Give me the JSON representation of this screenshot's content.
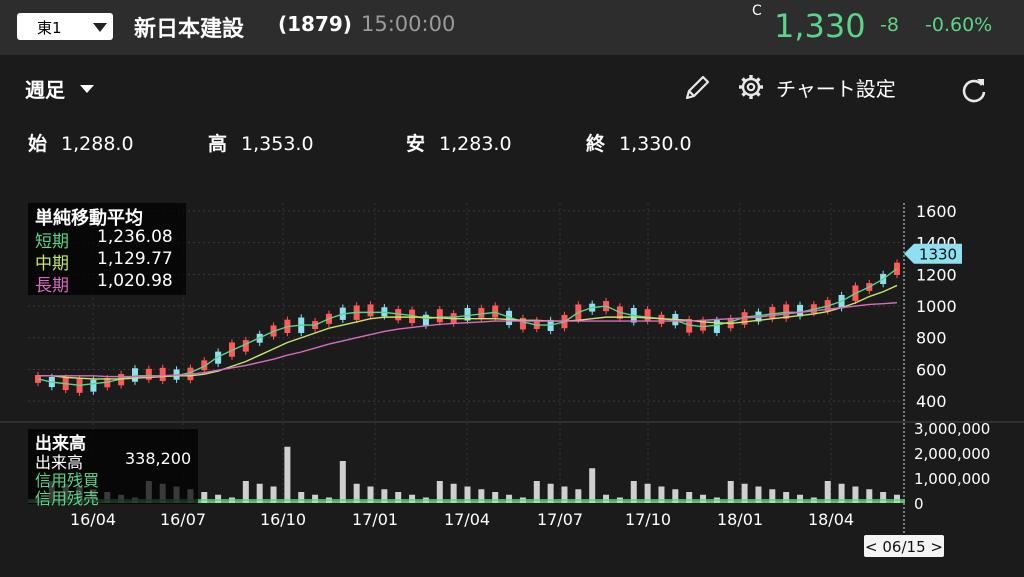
{
  "header": {
    "market": "東1",
    "name": "新日本建設",
    "code": "(1879)",
    "time": "15:00:00",
    "c_mark": "C",
    "price": "1,330",
    "change": "-8",
    "change_pct": "-0.60%"
  },
  "toolbar": {
    "period": "週足",
    "settings_label": "チャート設定"
  },
  "ohlc": {
    "open_label": "始",
    "open": "1,288.0",
    "high_label": "高",
    "high": "1,353.0",
    "low_label": "安",
    "low": "1,283.0",
    "close_label": "終",
    "close": "1,330.0"
  },
  "ma_legend": {
    "title": "単純移動平均",
    "short_label": "短期",
    "short_value": "1,236.08",
    "mid_label": "中期",
    "mid_value": "1,129.77",
    "long_label": "長期",
    "long_value": "1,020.98"
  },
  "volume_legend": {
    "title": "出来高",
    "volume_label": "出来高",
    "volume_value": "338,200",
    "margin_buy_label": "信用残買",
    "margin_sell_label": "信用残売"
  },
  "colors": {
    "up": "#ff5a5a",
    "down": "#8ee0f0",
    "short_ma": "#5bd48a",
    "mid_ma": "#c6e66a",
    "long_ma": "#d76cc0",
    "accent": "#5bd48a",
    "price_tag": "#8ee0f0"
  },
  "chart_data": {
    "type": "candlestick",
    "price_axis_ticks": [
      "1600",
      "1400",
      "1200",
      "1000",
      "800",
      "600",
      "400"
    ],
    "price_ylim": [
      300,
      1650
    ],
    "volume_axis_ticks": [
      "3,000,000",
      "2,000,000",
      "1,000,000",
      "0"
    ],
    "volume_ylim": [
      0,
      3000000
    ],
    "x_ticks": [
      "16/04",
      "16/07",
      "16/10",
      "17/01",
      "17/04",
      "17/07",
      "17/10",
      "18/01",
      "18/04"
    ],
    "last_price_tag": "1330",
    "cursor_date": "< 06/15 >",
    "series": [
      {
        "name": "短期",
        "values": [
          540,
          520,
          510,
          500,
          510,
          520,
          540,
          560,
          560,
          560,
          560,
          580,
          620,
          680,
          720,
          760,
          800,
          840,
          870,
          880,
          880,
          920,
          950,
          960,
          960,
          960,
          950,
          940,
          920,
          930,
          930,
          940,
          950,
          960,
          930,
          900,
          880,
          880,
          900,
          960,
          990,
          1000,
          960,
          940,
          930,
          920,
          910,
          880,
          870,
          880,
          900,
          930,
          940,
          950,
          960,
          960,
          980,
          1000,
          1030,
          1080,
          1120,
          1170,
          1236
        ]
      },
      {
        "name": "中期",
        "values": [
          560,
          560,
          550,
          545,
          540,
          540,
          540,
          545,
          550,
          555,
          560,
          560,
          570,
          590,
          620,
          650,
          690,
          730,
          770,
          800,
          830,
          860,
          880,
          900,
          920,
          930,
          930,
          930,
          930,
          925,
          920,
          920,
          920,
          920,
          915,
          910,
          910,
          905,
          905,
          910,
          920,
          930,
          930,
          930,
          925,
          920,
          915,
          910,
          900,
          895,
          890,
          900,
          910,
          920,
          930,
          940,
          950,
          965,
          990,
          1020,
          1060,
          1090,
          1130
        ]
      },
      {
        "name": "長期",
        "values": [
          560,
          560,
          560,
          560,
          560,
          555,
          555,
          555,
          555,
          560,
          565,
          570,
          580,
          595,
          610,
          625,
          645,
          665,
          690,
          710,
          735,
          760,
          780,
          800,
          820,
          840,
          855,
          865,
          875,
          885,
          890,
          895,
          900,
          905,
          905,
          905,
          905,
          905,
          905,
          905,
          905,
          905,
          905,
          905,
          905,
          905,
          905,
          905,
          910,
          915,
          920,
          925,
          930,
          940,
          950,
          960,
          970,
          980,
          990,
          1000,
          1010,
          1015,
          1021
        ]
      }
    ]
  }
}
